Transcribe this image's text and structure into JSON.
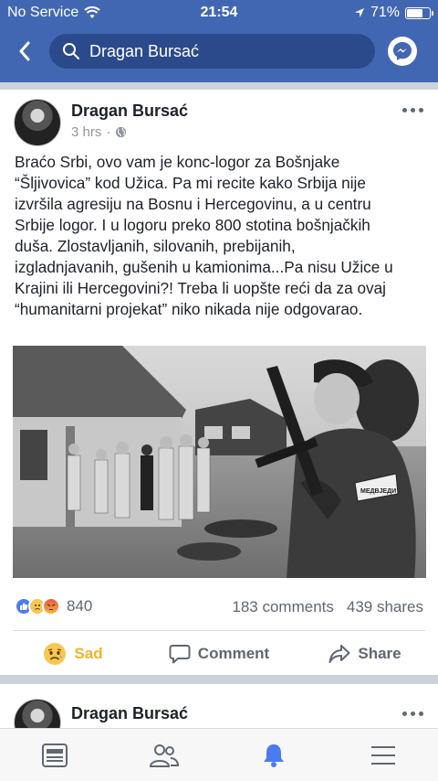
{
  "status_bar": {
    "carrier": "No Service",
    "time": "21:54",
    "battery": "71%",
    "battery_level": 0.71
  },
  "header": {
    "search_value": "Dragan Bursać"
  },
  "post": {
    "author": "Dragan Bursać",
    "time": "3 hrs",
    "text_lines": [
      "Braćo Srbi, ovo vam je konc-logor za Bošnjake",
      "“Šljivovica” kod Užica. Pa mi recite kako Srbija nije",
      "izvršila agresiju na Bosnu i Hercegovinu, a u centru",
      "Srbije logor. I u logoru preko 800 stotina bošnjačkih",
      "duša. Zlostavljanih, silovanih, prebijanih,",
      "izgladnjavanih, gušenih u kamionima...Pa nisu Užice u",
      "Krajini ili Hercegovini?! Treba li uopšte reći da za ovaj",
      "“humanitarni projekat” niko nikada nije odgovarao."
    ],
    "reaction_count": "840",
    "comments": "183 comments",
    "shares": "439 shares",
    "badge_text": "МЕДВЈЕДИ",
    "actions": {
      "reaction": "Sad",
      "comment": "Comment",
      "share": "Share"
    }
  },
  "next_post": {
    "author": "Dragan Bursać"
  },
  "tabbar": [
    "news-feed",
    "friends",
    "notifications",
    "menu"
  ]
}
